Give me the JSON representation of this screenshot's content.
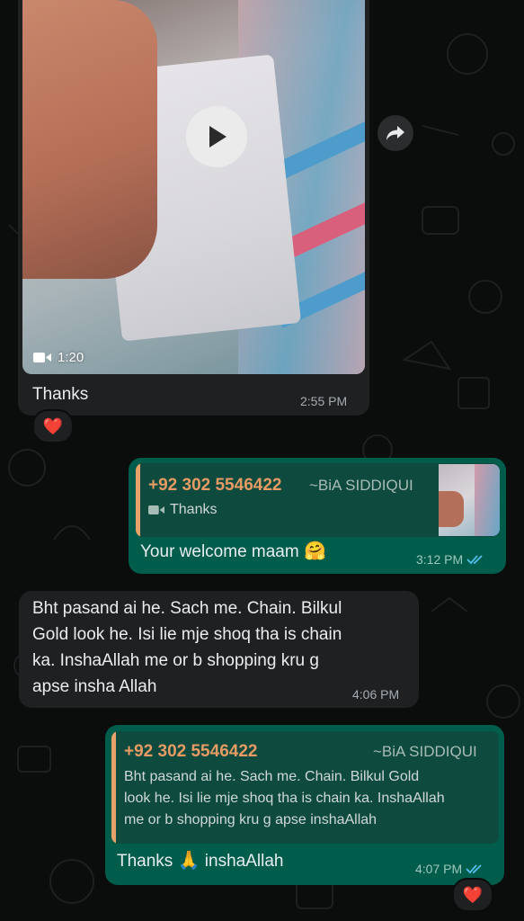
{
  "messages": {
    "video_msg": {
      "duration": "1:20",
      "text": "Thanks",
      "time": "2:55 PM",
      "reaction": "❤️"
    },
    "reply1": {
      "quote_sender": "+92 302 5546422",
      "quote_name": "~BiA SIDDIQUI",
      "quote_text": "Thanks",
      "text": "Your welcome maam",
      "emoji": "🤗",
      "time": "3:12 PM"
    },
    "incoming2": {
      "lines": [
        "Bht pasand ai he. Sach me.  Chain.  Bilkul",
        "Gold  look he. Isi lie mje shoq tha is chain",
        "ka.   InshaAllah me or b shopping kru g",
        "apse insha Allah"
      ],
      "time": "4:06 PM"
    },
    "reply2": {
      "quote_sender": "+92 302 5546422",
      "quote_name": "~BiA SIDDIQUI",
      "quote_lines": [
        "Bht pasand ai he. Sach me.  Chain.  Bilkul Gold",
        "look he. Isi lie mje shoq tha is chain ka.   InshaAllah",
        "me or b shopping kru g apse inshaAllah"
      ],
      "text_before": "Thanks",
      "emoji": "🙏",
      "text_after": "inshaAllah",
      "time": "4:07 PM",
      "reaction": "❤️"
    }
  },
  "colors": {
    "background": "#0b0c0c",
    "incoming_bubble": "#1f2022",
    "outgoing_bubble": "#005c4b",
    "quote_accent": "#e6a26a",
    "read_ticks": "#53bdeb"
  },
  "icons": [
    "play-icon",
    "video-camera-icon",
    "forward-icon",
    "double-check-icon",
    "heart-reaction"
  ]
}
